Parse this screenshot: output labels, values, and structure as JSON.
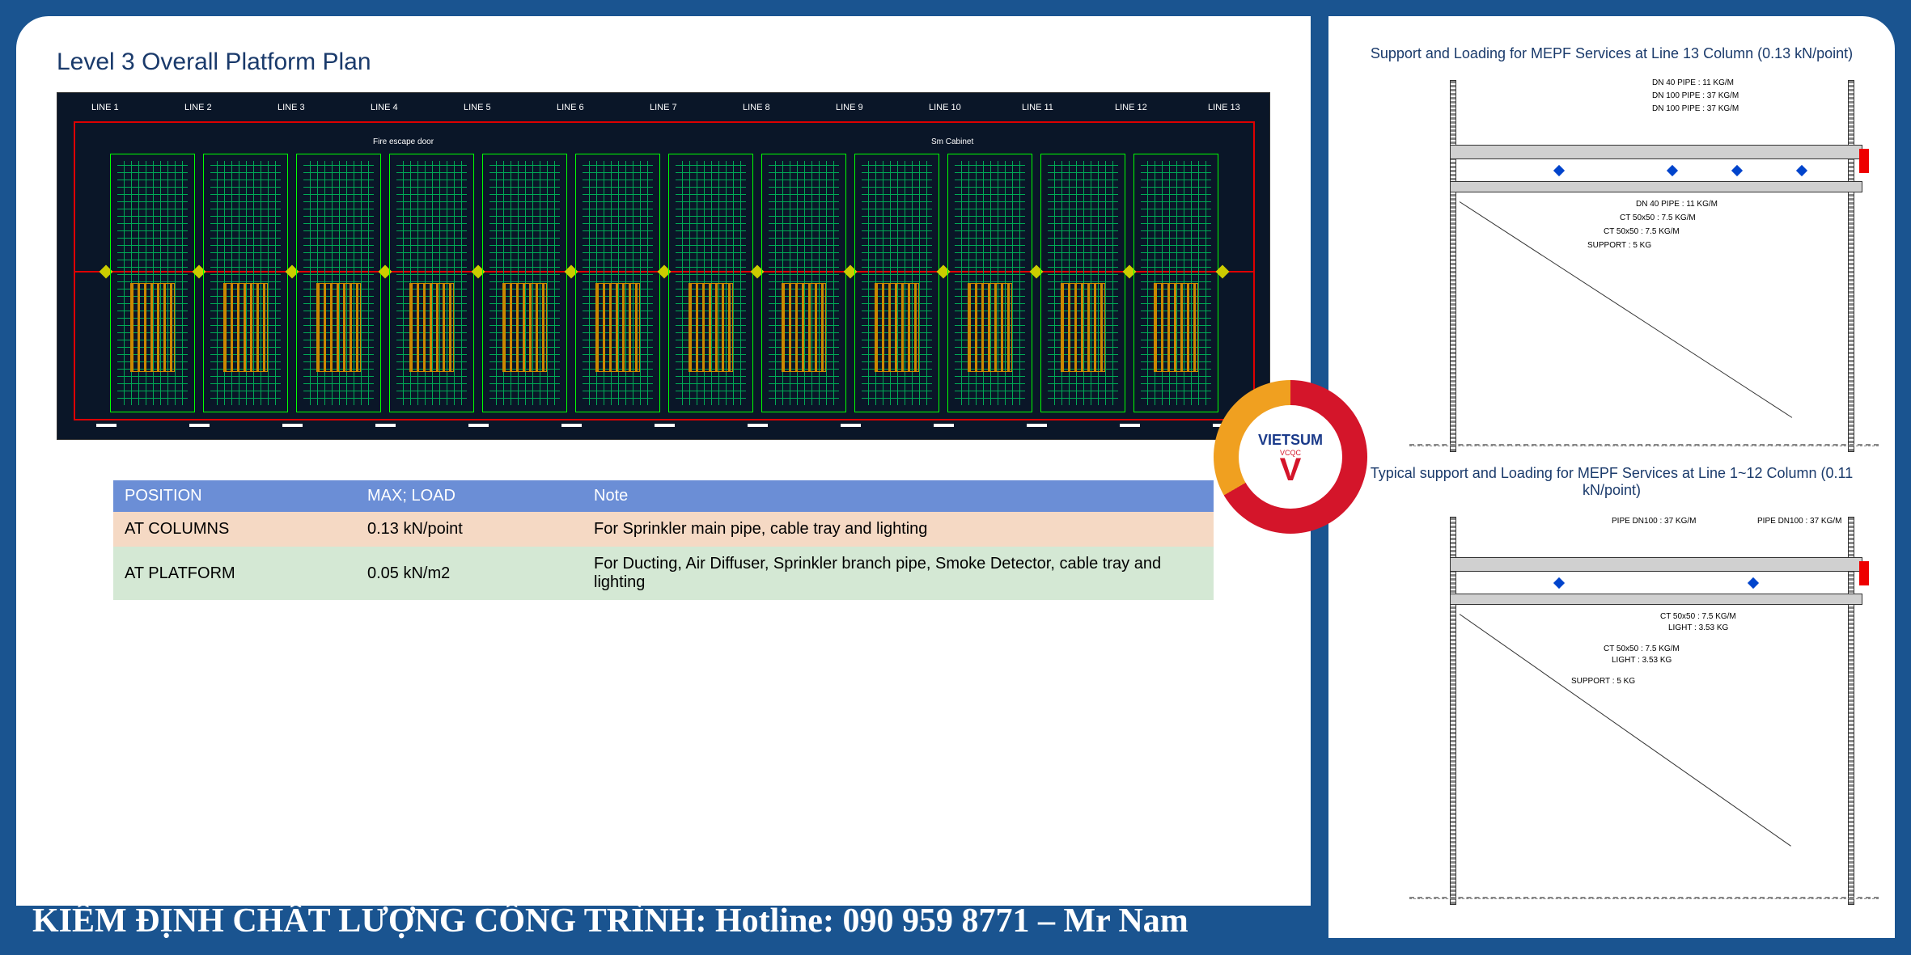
{
  "page": {
    "title": "Level 3 Overall Platform Plan",
    "footer": "KIỂM ĐỊNH CHẤT LƯỢNG CÔNG TRÌNH: Hotline: 090 959 8771 – Mr Nam"
  },
  "lines": [
    "LINE 1",
    "LINE 2",
    "LINE 3",
    "LINE 4",
    "LINE 5",
    "LINE 6",
    "LINE 7",
    "LINE 8",
    "LINE 9",
    "LINE 10",
    "LINE 11",
    "LINE 12",
    "LINE 13"
  ],
  "cad_labels": {
    "fire_escape": "Fire escape door",
    "cabinet": "Sm Cabinet"
  },
  "table": {
    "headers": [
      "POSITION",
      "MAX; LOAD",
      "Note"
    ],
    "rows": [
      {
        "pos": "AT COLUMNS",
        "load": "0.13 kN/point",
        "note": "For Sprinkler main pipe, cable tray and lighting"
      },
      {
        "pos": "AT PLATFORM",
        "load": "0.05 kN/m2",
        "note": "For Ducting, Air Diffuser, Sprinkler branch pipe, Smoke Detector, cable tray and lighting"
      }
    ]
  },
  "detail1": {
    "title": "Support and Loading for MEPF Services at Line 13 Column (0.13 kN/point)",
    "labels": [
      "DN 40 PIPE : 11 KG/M",
      "DN 100 PIPE : 37 KG/M",
      "DN 100 PIPE : 37 KG/M",
      "DN 40 PIPE : 11 KG/M",
      "CT 50x50 : 7.5 KG/M",
      "CT 50x50 : 7.5 KG/M",
      "SUPPORT : 5 KG"
    ]
  },
  "detail2": {
    "title": "Typical support and Loading for MEPF Services at Line 1~12 Column (0.11 kN/point)",
    "labels": [
      "PIPE DN100 : 37 KG/M",
      "PIPE DN100 : 37 KG/M",
      "CT 50x50 : 7.5 KG/M",
      "LIGHT : 3.53 KG",
      "CT 50x50 : 7.5 KG/M",
      "LIGHT : 3.53 KG",
      "SUPPORT : 5 KG"
    ]
  },
  "logo": {
    "main": "VIETSUM",
    "sub": "VCQC"
  }
}
